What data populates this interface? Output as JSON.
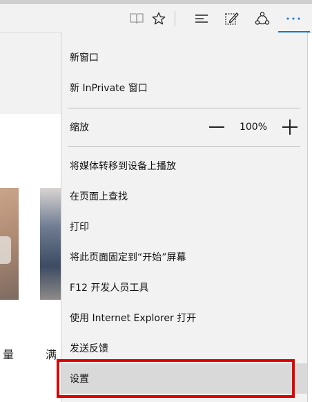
{
  "toolbar": {
    "icons": [
      "reading-view-icon",
      "favorite-star-icon",
      "hub-icon",
      "web-note-icon",
      "share-icon",
      "more-icon"
    ],
    "accent_color": "#0078d7"
  },
  "page": {
    "text_left": "量",
    "text_right": "满"
  },
  "menu": {
    "items": [
      {
        "label": "新窗口"
      },
      {
        "label": "新 InPrivate 窗口"
      },
      {
        "label": "缩放"
      },
      {
        "label": "将媒体转移到设备上播放"
      },
      {
        "label": "在页面上查找"
      },
      {
        "label": "打印"
      },
      {
        "label": "将此页面固定到“开始”屏幕"
      },
      {
        "label": "F12 开发人员工具"
      },
      {
        "label": "使用 Internet Explorer 打开"
      },
      {
        "label": "发送反馈"
      },
      {
        "label": "设置"
      }
    ],
    "zoom": {
      "value": "100%"
    }
  },
  "highlight_color": "#e00000"
}
